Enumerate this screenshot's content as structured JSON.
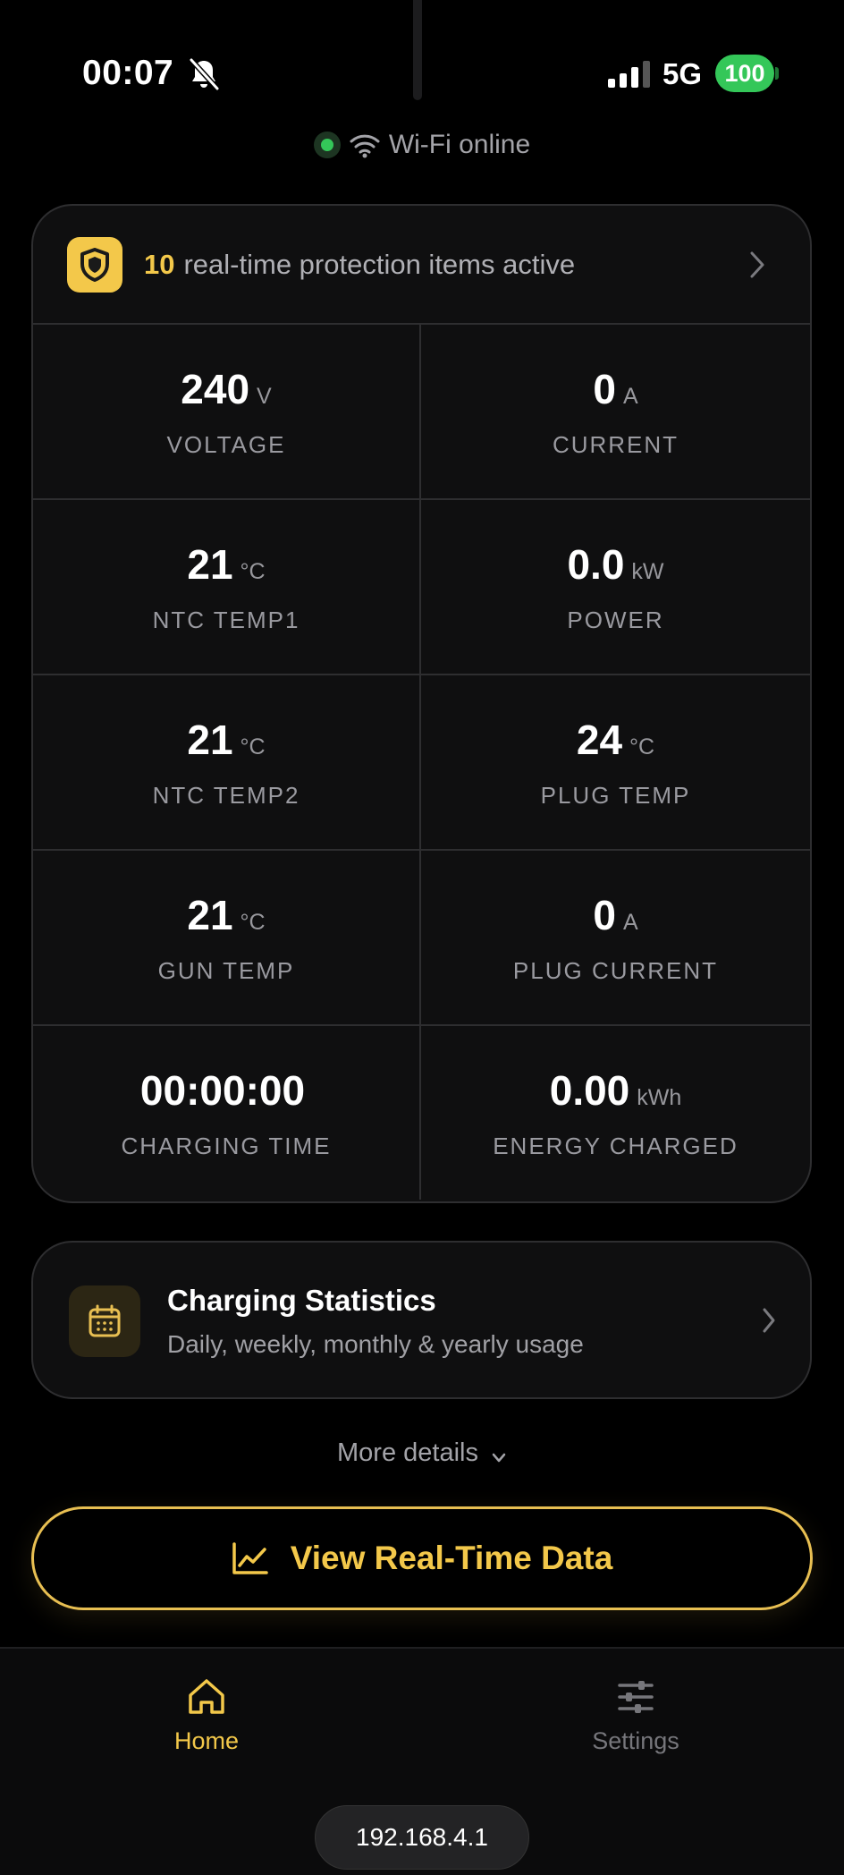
{
  "status_bar": {
    "time": "00:07",
    "network": "5G",
    "battery": "100"
  },
  "connection": {
    "label": "Wi-Fi online",
    "color": "#34c759"
  },
  "protection": {
    "count": "10",
    "text": "real-time protection items active"
  },
  "metrics": [
    {
      "value": "240",
      "unit": "V",
      "label": "VOLTAGE"
    },
    {
      "value": "0",
      "unit": "A",
      "label": "CURRENT"
    },
    {
      "value": "21",
      "unit": "°C",
      "label": "NTC TEMP1"
    },
    {
      "value": "0.0",
      "unit": "kW",
      "label": "POWER"
    },
    {
      "value": "21",
      "unit": "°C",
      "label": "NTC TEMP2"
    },
    {
      "value": "24",
      "unit": "°C",
      "label": "PLUG TEMP"
    },
    {
      "value": "21",
      "unit": "°C",
      "label": "GUN TEMP"
    },
    {
      "value": "0",
      "unit": "A",
      "label": "PLUG CURRENT"
    },
    {
      "value": "00:00:00",
      "unit": "",
      "label": "CHARGING TIME"
    },
    {
      "value": "0.00",
      "unit": "kWh",
      "label": "ENERGY CHARGED"
    }
  ],
  "stats": {
    "title": "Charging Statistics",
    "subtitle": "Daily, weekly, monthly & yearly usage"
  },
  "more_details": "More details",
  "realtime_button": "View Real-Time Data",
  "tabs": {
    "home": "Home",
    "settings": "Settings"
  },
  "ip_address": "192.168.4.1",
  "colors": {
    "accent": "#f3c84a",
    "background": "#000000",
    "success": "#34c759"
  }
}
